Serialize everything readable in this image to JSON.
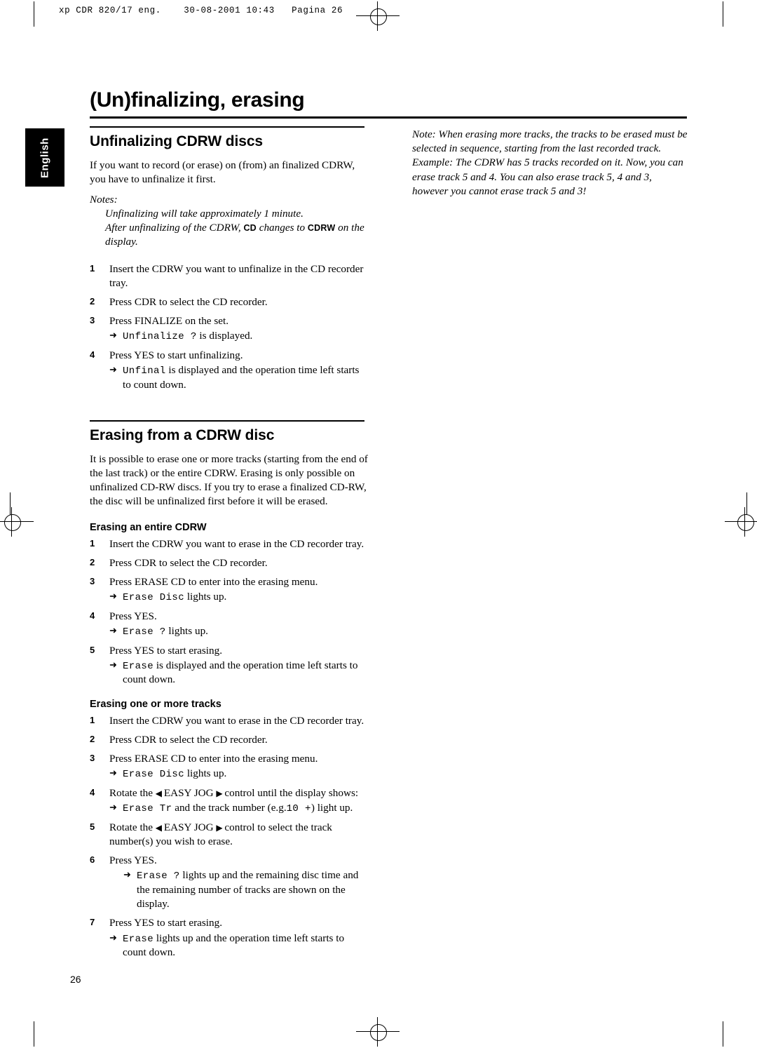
{
  "printer_header": "xp CDR 820/17 eng.    30-08-2001 10:43   Pagina 26",
  "page_title": "(Un)finalizing, erasing",
  "language_tab": "English",
  "page_number": "26",
  "left_column": {
    "section1": {
      "heading": "Unfinalizing CDRW discs",
      "intro": "If you want to record (or erase) on (from) an finalized CDRW, you have to unfinalize it first.",
      "notes_label": "Notes:",
      "note1": "Unfinalizing will take approximately 1 minute.",
      "note2_part1": "After unfinalizing of the CDRW,",
      "note2_cd": "CD",
      "note2_part2": "changes to",
      "note2_cdrw": "CDRW",
      "note2_part3": "on the display.",
      "steps": [
        {
          "num": "1",
          "text": "Insert the CDRW you want to unfinalize in the CD recorder tray."
        },
        {
          "num": "2",
          "text": "Press CDR to select the CD recorder."
        },
        {
          "num": "3",
          "text": "Press FINALIZE on the set.",
          "result_mono": "Unfinalize ?",
          "result_after": "is displayed."
        },
        {
          "num": "4",
          "text": "Press YES to start unfinalizing.",
          "result_mono": "Unfinal",
          "result_after": "is displayed and the operation time left starts to count down."
        }
      ]
    },
    "section2": {
      "heading": "Erasing from a CDRW disc",
      "intro": "It is possible to erase one or more tracks (starting from the end of the last track) or the entire CDRW. Erasing is only possible on unfinalized CD-RW discs. If you try to erase a finalized CD-RW, the disc will be unfinalized first before it will be erased.",
      "sub1": {
        "heading": "Erasing an entire CDRW",
        "steps": [
          {
            "num": "1",
            "text": "Insert the CDRW you want to erase in the CD recorder tray."
          },
          {
            "num": "2",
            "text": "Press CDR to select the CD recorder."
          },
          {
            "num": "3",
            "text": "Press ERASE CD to enter into the erasing menu.",
            "result_mono": "Erase Disc",
            "result_after": "lights up."
          },
          {
            "num": "4",
            "text": "Press YES.",
            "result_mono": "Erase ?",
            "result_after": "lights up."
          },
          {
            "num": "5",
            "text": "Press YES to start erasing.",
            "result_mono": "Erase",
            "result_after": "is displayed and the operation time left starts to count down."
          }
        ]
      },
      "sub2": {
        "heading": "Erasing one or more tracks",
        "steps": [
          {
            "num": "1",
            "text": "Insert the CDRW you want to erase in the CD recorder tray."
          },
          {
            "num": "2",
            "text": "Press CDR to select the CD recorder."
          },
          {
            "num": "3",
            "text": "Press ERASE CD to enter into the erasing menu.",
            "result_mono": "Erase Disc",
            "result_after": "lights up."
          },
          {
            "num": "4",
            "text_before": "Rotate the",
            "jog_left": "◀",
            "text_mid": "EASY JOG",
            "jog_right": "▶",
            "text_after": "control until the display shows:",
            "result_mono": "Erase Tr",
            "result_mid": "and the track number (e.g.",
            "result_mono2": "10 +",
            "result_after": ") light up."
          },
          {
            "num": "5",
            "text_before": "Rotate the",
            "jog_left": "◀",
            "text_mid": "EASY JOG",
            "jog_right": "▶",
            "text_after": "control to select the track number(s) you wish to erase."
          },
          {
            "num": "6",
            "text": "Press YES.",
            "result_mono": "Erase ?",
            "result_after": "lights up and the remaining disc time and the remaining number of tracks are shown on the display."
          },
          {
            "num": "7",
            "text": "Press YES to start erasing.",
            "result_mono": "Erase",
            "result_after": "lights up and the operation time left starts to count down."
          }
        ]
      }
    }
  },
  "right_column": {
    "note": "Note: When erasing more tracks, the tracks to be erased must be selected in sequence, starting from the last recorded track. Example: The CDRW has 5 tracks recorded on it. Now, you can erase track 5 and 4. You can also erase track 5, 4 and 3, however you cannot erase track 5 and 3!"
  }
}
